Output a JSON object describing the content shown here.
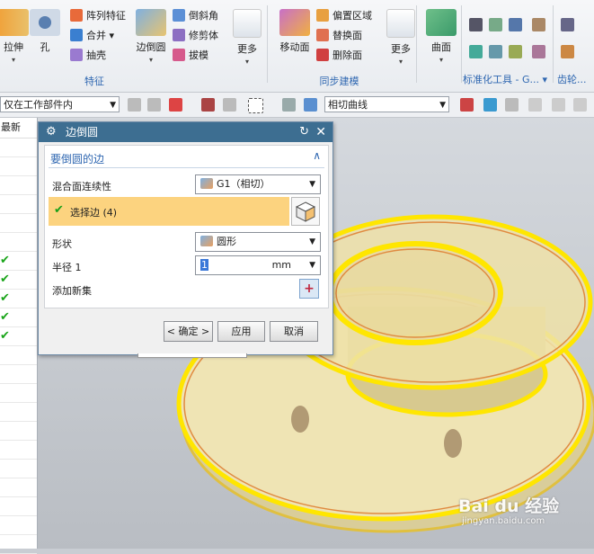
{
  "ribbon": {
    "feature": {
      "group_label": "特征",
      "extrude_label": "拉伸",
      "hole_label": "孔",
      "pattern_label": "阵列特征",
      "unite_label": "合并",
      "shell_label": "抽壳",
      "edge_blend_label": "边倒圆",
      "chamfer_label": "倒斜角",
      "trim_body_label": "修剪体",
      "draft_label": "拔模",
      "more_label": "更多"
    },
    "sync": {
      "group_label": "同步建模",
      "move_face_label": "移动面",
      "offset_region_label": "偏置区域",
      "replace_face_label": "替换面",
      "delete_face_label": "删除面",
      "more_label": "更多"
    },
    "surface": {
      "label": "曲面"
    },
    "std_tools": {
      "group_label": "标准化工具 - G..."
    },
    "gear": {
      "group_label": "齿轮..."
    }
  },
  "toolbar": {
    "scope_select": "仅在工作部件内",
    "curve_rule_select": "相切曲线"
  },
  "left_panel": {
    "header": "最新",
    "checks": [
      "✔",
      "✔",
      "✔",
      "✔",
      "✔"
    ]
  },
  "dialog": {
    "title": "边倒圆",
    "section_title": "要倒圆的边",
    "continuity_label": "混合面连续性",
    "continuity_value": "G1（相切）",
    "select_edge_label": "选择边 (4)",
    "shape_label": "形状",
    "shape_value": "圆形",
    "radius_label": "半径 1",
    "radius_value": "1",
    "radius_unit": "mm",
    "add_new_set_label": "添加新集",
    "ok_label": "< 确定 >",
    "apply_label": "应用",
    "cancel_label": "取消"
  },
  "watermark": {
    "brand": "Bai du 经验",
    "url": "jingyan.baidu.com"
  },
  "colors": {
    "title_bar": "#3d6e91",
    "selection_row": "#fcd37f",
    "accent_blue": "#2f67b1",
    "model_face": "#eedc9a",
    "highlight_edge": "#ffe600"
  }
}
